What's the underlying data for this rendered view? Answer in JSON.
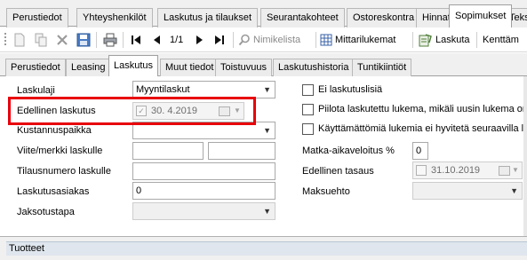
{
  "top_tabs": [
    "Perustiedot",
    "Yhteyshenkilöt",
    "Laskutus ja tilaukset",
    "Seurantakohteet",
    "Ostoreskontra",
    "Hinnat",
    "Sopimukset",
    "Tekstit"
  ],
  "top_tab_active": "Sopimukset",
  "toolbar": {
    "record_position": "1/1",
    "nimikelista_label": "Nimikelista",
    "mittarilukemat_label": "Mittarilukemat",
    "laskuta_label": "Laskuta",
    "kenttamies_label": "Kenttäm"
  },
  "inner_tabs": [
    "Perustiedot",
    "Leasing",
    "Laskutus",
    "Muut tiedot",
    "Toistuvuus",
    "Laskutushistoria",
    "Tuntikiintiöt"
  ],
  "inner_tab_active": "Laskutus",
  "form": {
    "laskulaji_label": "Laskulaji",
    "laskulaji_value": "Myyntilaskut",
    "edellinen_laskutus_label": "Edellinen laskutus",
    "edellinen_laskutus_value": "30.  4.2019",
    "kustannuspaikka_label": "Kustannuspaikka",
    "kustannuspaikka_value": "",
    "viite_label": "Viite/merkki laskulle",
    "viite_value_1": "",
    "viite_value_2": "",
    "tilausnumero_label": "Tilausnumero laskulle",
    "tilausnumero_value": "",
    "laskutusasiakas_label": "Laskutusasiakas",
    "laskutusasiakas_value": "0",
    "jaksotustapa_label": "Jaksotustapa",
    "jaksotustapa_value": ""
  },
  "right_form": {
    "ei_laskutuslisia": "Ei laskutuslisiä",
    "piilota_label": "Piilota laskutettu lukema, mikäli uusin lukema on pi",
    "kayttamattomia_label": "Käyttämättömiä lukemia ei hyvitetä seuraavilla lask",
    "matka_label": "Matka-aikaveloitus %",
    "matka_value": "0",
    "edellinen_tasaus_label": "Edellinen tasaus",
    "edellinen_tasaus_value": "31.10.2019",
    "maksuehto_label": "Maksuehto",
    "maksuehto_value": ""
  },
  "bottom": {
    "tuotteet_label": "Tuotteet"
  },
  "colors": {
    "highlight": "#e8000b"
  }
}
